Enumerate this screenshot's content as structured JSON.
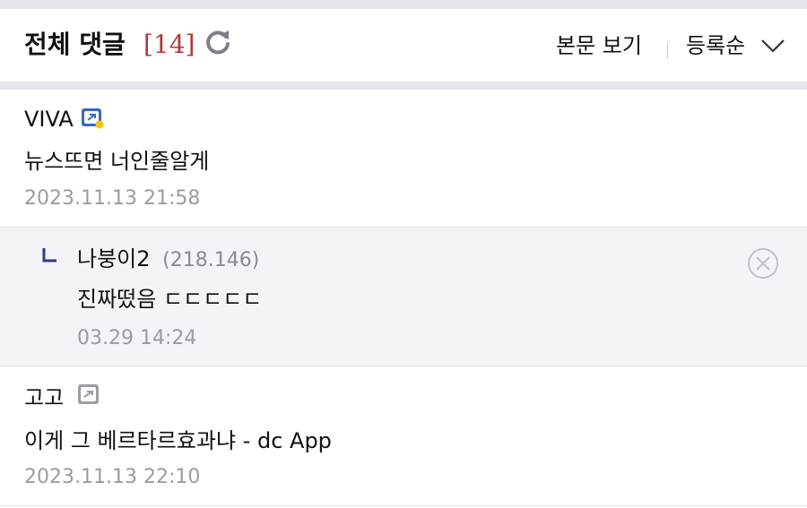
{
  "header": {
    "title": "전체 댓글",
    "count": "[14]",
    "view_body_label": "본문 보기",
    "sort_label": "등록순"
  },
  "comments": [
    {
      "nickname": "VIVA",
      "badge": "fixed-nick-icon",
      "content": "뉴스뜨면 너인줄알게",
      "date": "2023.11.13 21:58"
    },
    {
      "nickname": "나붕이2",
      "ip": "(218.146)",
      "content": "진짜떴음 ㄷㄷㄷㄷㄷ",
      "date": "03.29 14:24",
      "is_reply": true
    },
    {
      "nickname": "고고",
      "badge": "half-fixed-nick-icon",
      "content": "이게 그 베르타르효과냐 - dc App",
      "date": "2023.11.13 22:10"
    }
  ],
  "colors": {
    "count": "#b3373a",
    "reply_bg": "#f3f4f8",
    "date": "#9a9aa4",
    "separator": "#e6e6ec"
  }
}
